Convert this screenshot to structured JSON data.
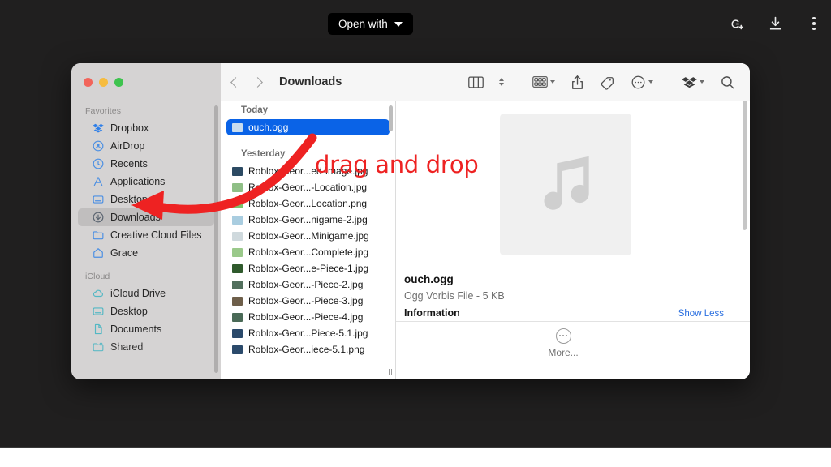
{
  "appbar": {
    "open_with_label": "Open with",
    "icons": [
      {
        "name": "add-to-lens-icon",
        "glyph": "G+"
      },
      {
        "name": "download-icon",
        "glyph": "download"
      },
      {
        "name": "overflow-menu-icon",
        "glyph": "kebab"
      }
    ]
  },
  "finder": {
    "title": "Downloads",
    "back_label": "Back",
    "forward_label": "Forward",
    "toolbar_buttons": [
      {
        "name": "view-columns-button",
        "label": "Column view"
      },
      {
        "name": "view-sort-stepper",
        "label": "Sort order"
      },
      {
        "name": "group-by-button",
        "label": "Group"
      },
      {
        "name": "share-button",
        "label": "Share"
      },
      {
        "name": "tags-button",
        "label": "Tags"
      },
      {
        "name": "action-menu-button",
        "label": "Actions"
      },
      {
        "name": "dropbox-button",
        "label": "Dropbox"
      },
      {
        "name": "search-button",
        "label": "Search"
      }
    ],
    "sidebar": {
      "sections": [
        {
          "header": "Favorites",
          "items": [
            {
              "label": "Dropbox",
              "icon": "dropbox-icon",
              "selected": false
            },
            {
              "label": "AirDrop",
              "icon": "airdrop-icon",
              "selected": false
            },
            {
              "label": "Recents",
              "icon": "clock-icon",
              "selected": false
            },
            {
              "label": "Applications",
              "icon": "applications-icon",
              "selected": false
            },
            {
              "label": "Desktop",
              "icon": "desktop-icon",
              "selected": false
            },
            {
              "label": "Downloads",
              "icon": "downloads-icon",
              "selected": true
            },
            {
              "label": "Creative Cloud Files",
              "icon": "folder-icon",
              "selected": false
            },
            {
              "label": "Grace",
              "icon": "home-icon",
              "selected": false
            }
          ]
        },
        {
          "header": "iCloud",
          "items": [
            {
              "label": "iCloud Drive",
              "icon": "cloud-icon",
              "selected": false
            },
            {
              "label": "Desktop",
              "icon": "desktop-icon",
              "selected": false
            },
            {
              "label": "Documents",
              "icon": "document-icon",
              "selected": false
            },
            {
              "label": "Shared",
              "icon": "shared-folder-icon",
              "selected": false
            }
          ]
        }
      ]
    },
    "filelist": {
      "groups": [
        {
          "label": "Today",
          "files": [
            {
              "name": "ouch.ogg",
              "selected": true,
              "thumb": "#c8dcef"
            }
          ]
        },
        {
          "label": "Yesterday",
          "files": [
            {
              "name": "Roblox-Geor...ed-Image.jpg",
              "selected": false,
              "thumb": "#2c4a63"
            },
            {
              "name": "Roblox-Geor...-Location.jpg",
              "selected": false,
              "thumb": "#8fbf86"
            },
            {
              "name": "Roblox-Geor...Location.png",
              "selected": false,
              "thumb": "#7cc36b"
            },
            {
              "name": "Roblox-Geor...nigame-2.jpg",
              "selected": false,
              "thumb": "#a9cde0"
            },
            {
              "name": "Roblox-Geor...Minigame.jpg",
              "selected": false,
              "thumb": "#cfd9dd"
            },
            {
              "name": "Roblox-Geor...Complete.jpg",
              "selected": false,
              "thumb": "#9ac98a"
            },
            {
              "name": "Roblox-Geor...e-Piece-1.jpg",
              "selected": false,
              "thumb": "#2f5a2c"
            },
            {
              "name": "Roblox-Geor...-Piece-2.jpg",
              "selected": false,
              "thumb": "#53705e"
            },
            {
              "name": "Roblox-Geor...-Piece-3.jpg",
              "selected": false,
              "thumb": "#6e5f4a"
            },
            {
              "name": "Roblox-Geor...-Piece-4.jpg",
              "selected": false,
              "thumb": "#4a6a57"
            },
            {
              "name": "Roblox-Geor...Piece-5.1.jpg",
              "selected": false,
              "thumb": "#2b4a6b"
            },
            {
              "name": "Roblox-Geor...iece-5.1.png",
              "selected": false,
              "thumb": "#2b4a6b"
            }
          ]
        }
      ]
    },
    "preview": {
      "artwork_icon": "music-note-icon",
      "file_name": "ouch.ogg",
      "file_meta": "Ogg Vorbis File - 5 KB",
      "information_label": "Information",
      "show_less_label": "Show Less",
      "more_label": "More...",
      "more_icon": "ellipsis-circle-icon"
    }
  },
  "annotation": {
    "text": "drag and drop",
    "color": "#ee2222"
  },
  "colors": {
    "selection_blue": "#0a63e7",
    "sidebar_bg": "#d5d3d3",
    "app_bg": "#201f1f",
    "traffic_red": "#f2645a",
    "traffic_yellow": "#f6bc3f",
    "traffic_green": "#3ec34e"
  }
}
